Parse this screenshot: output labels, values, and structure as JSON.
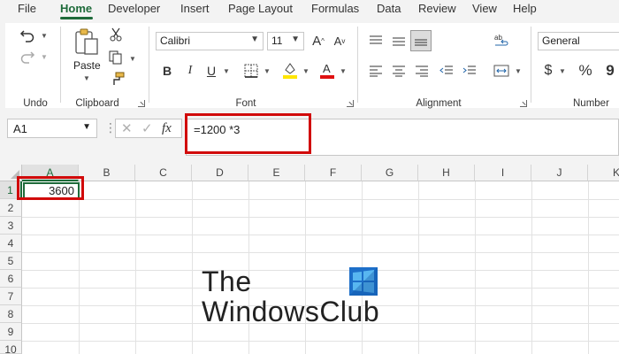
{
  "menu": {
    "tabs": [
      "File",
      "Home",
      "Developer",
      "Insert",
      "Page Layout",
      "Formulas",
      "Data",
      "Review",
      "View",
      "Help"
    ],
    "active_index": 1
  },
  "ribbon": {
    "groups": {
      "undo": "Undo",
      "clipboard": "Clipboard",
      "font": "Font",
      "alignment": "Alignment",
      "number": "Number"
    },
    "paste_label": "Paste",
    "font_name": "Calibri",
    "font_size": "11",
    "number_format": "General",
    "bold_label": "B",
    "italic_label": "I",
    "underline_label": "U",
    "increase_font_label": "A",
    "decrease_font_label": "A",
    "currency_symbol": "$",
    "percent_symbol": "%",
    "comma_symbol": "9"
  },
  "formula_bar": {
    "name_box": "A1",
    "fx_label": "fx",
    "formula": "=1200 *3"
  },
  "sheet": {
    "columns": [
      "A",
      "B",
      "C",
      "D",
      "E",
      "F",
      "G",
      "H",
      "I",
      "J",
      "K"
    ],
    "rows": [
      "1",
      "2",
      "3",
      "4",
      "5",
      "6",
      "7",
      "8",
      "9",
      "10"
    ],
    "cell_a1": "3600",
    "selected_column": "A",
    "selected_row": "1"
  },
  "watermark": {
    "line1": "The",
    "line2": "WindowsClub"
  },
  "colors": {
    "excel_green": "#1e6b3a",
    "highlight_red": "#d10a0a"
  }
}
